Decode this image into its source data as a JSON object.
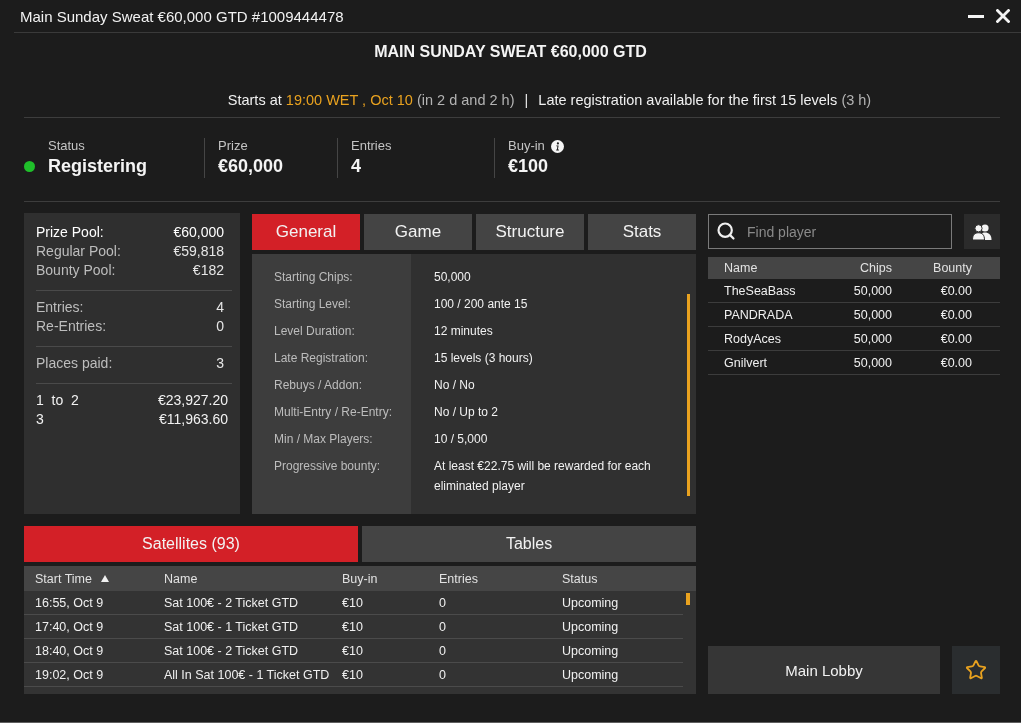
{
  "window": {
    "title": "Main Sunday Sweat €60,000 GTD #1009444478"
  },
  "header": {
    "title": "MAIN SUNDAY SWEAT €60,000 GTD",
    "schedule": [
      {
        "kind": "plain",
        "text": "Starts at"
      },
      {
        "kind": "highlight",
        "text": "19:00 WET , Oct 10"
      },
      {
        "kind": "muted",
        "text": "(in 2 d and 2 h)"
      },
      {
        "kind": "separator",
        "text": "|"
      },
      {
        "kind": "plain",
        "text": "Late registration available for the first 15 levels"
      },
      {
        "kind": "muted",
        "text": "(3 h)"
      }
    ]
  },
  "summary": [
    {
      "kind": "status",
      "label": "Status",
      "value": "Registering",
      "color": "#1fbf2a"
    },
    {
      "kind": "plain",
      "label": "Prize",
      "value": "€60,000"
    },
    {
      "kind": "plain",
      "label": "Entries",
      "value": "4"
    },
    {
      "kind": "info",
      "label": "Buy-in",
      "value": "€100"
    }
  ],
  "prize_pool": {
    "groups": [
      {
        "rows": [
          {
            "kind": "total",
            "label": "Prize Pool:",
            "value": "€60,000"
          },
          {
            "kind": "detail",
            "label": "Regular Pool:",
            "value": "€59,818"
          },
          {
            "kind": "detail",
            "label": "Bounty Pool:",
            "value": "€182"
          }
        ]
      },
      {
        "rows": [
          {
            "kind": "detail",
            "label": "Entries:",
            "value": "4"
          },
          {
            "kind": "detail",
            "label": "Re-Entries:",
            "value": "0"
          }
        ]
      },
      {
        "rows": [
          {
            "kind": "detail",
            "label": "Places paid:",
            "value": "3"
          }
        ]
      },
      {
        "rows": [
          {
            "kind": "payout",
            "label": "1  to  2",
            "value": "€23,927.20"
          },
          {
            "kind": "payout",
            "label": "3",
            "value": "€11,963.60"
          }
        ]
      }
    ]
  },
  "info_tabs": [
    {
      "label": "General",
      "selected": true
    },
    {
      "label": "Game",
      "selected": false
    },
    {
      "label": "Structure",
      "selected": false
    },
    {
      "label": "Stats",
      "selected": false
    }
  ],
  "general": [
    {
      "label": "Starting Chips:",
      "value": "50,000"
    },
    {
      "label": "Starting Level:",
      "value": "100 / 200 ante 15"
    },
    {
      "label": "Level Duration:",
      "value": "12 minutes"
    },
    {
      "label": "Late Registration:",
      "value": "15 levels (3 hours)"
    },
    {
      "label": "Rebuys / Addon:",
      "value": "No / No"
    },
    {
      "label": "Multi-Entry / Re-Entry:",
      "value": "No / Up to 2"
    },
    {
      "label": "Min / Max Players:",
      "value": "10 / 5,000"
    },
    {
      "label": "Progressive bounty:",
      "value": "At least €22.75 will be rewarded for each eliminated player"
    }
  ],
  "player_search": {
    "placeholder": "Find player"
  },
  "players": {
    "columns": [
      "Name",
      "Chips",
      "Bounty"
    ],
    "rows": [
      [
        "TheSeaBass",
        "50,000",
        "€0.00"
      ],
      [
        "PANDRADA",
        "50,000",
        "€0.00"
      ],
      [
        "RodyAces",
        "50,000",
        "€0.00"
      ],
      [
        "Gnilvert",
        "50,000",
        "€0.00"
      ]
    ]
  },
  "list_tabs": [
    {
      "label": "Satellites (93)",
      "selected": true
    },
    {
      "label": "Tables",
      "selected": false
    }
  ],
  "satellites": {
    "columns": [
      {
        "label": "Start Time",
        "sorted": true
      },
      {
        "label": "Name",
        "sorted": false
      },
      {
        "label": "Buy-in",
        "sorted": false
      },
      {
        "label": "Entries",
        "sorted": false
      },
      {
        "label": "Status",
        "sorted": false
      }
    ],
    "rows": [
      [
        "16:55, Oct 9",
        "Sat 100€ - 2 Ticket GTD",
        "€10",
        "0",
        "Upcoming"
      ],
      [
        "17:40, Oct 9",
        "Sat 100€ - 1 Ticket GTD",
        "€10",
        "0",
        "Upcoming"
      ],
      [
        "18:40, Oct 9",
        "Sat 100€ - 2 Ticket GTD",
        "€10",
        "0",
        "Upcoming"
      ],
      [
        "19:02, Oct 9",
        "All In Sat 100€ - 1 Ticket GTD",
        "€10",
        "0",
        "Upcoming"
      ]
    ]
  },
  "actions": {
    "lobby_button": "Main Lobby",
    "favorite": false
  }
}
